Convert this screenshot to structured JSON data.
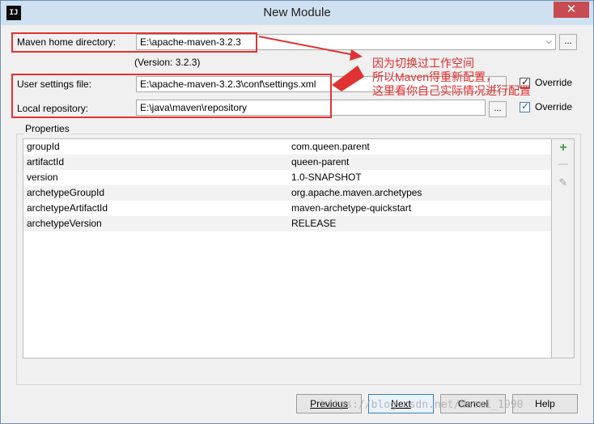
{
  "window": {
    "title": "New Module",
    "app_icon_text": "IJ",
    "close_glyph": "✕"
  },
  "maven": {
    "home_label": "Maven home directory:",
    "home_value": "E:\\apache-maven-3.2.3",
    "version_text": "(Version: 3.2.3)",
    "settings_label": "User settings file:",
    "settings_value": "E:\\apache-maven-3.2.3\\conf\\settings.xml",
    "repo_label": "Local repository:",
    "repo_value": "E:\\java\\maven\\repository",
    "override_label": "Override",
    "override_label_2": "Override",
    "browse_label": "...",
    "settings_override_checked": true,
    "repo_override_checked": true
  },
  "annotation": {
    "lines": [
      "因为切换过工作空间",
      "所以Maven得重新配置，",
      "这里看你自己实际情况进行配置"
    ],
    "color": "#e02b2b"
  },
  "properties": {
    "title": "Properties",
    "rows": [
      {
        "name": "groupId",
        "value": "com.queen.parent"
      },
      {
        "name": "artifactId",
        "value": "queen-parent"
      },
      {
        "name": "version",
        "value": "1.0-SNAPSHOT"
      },
      {
        "name": "archetypeGroupId",
        "value": "org.apache.maven.archetypes"
      },
      {
        "name": "archetypeArtifactId",
        "value": "maven-archetype-quickstart"
      },
      {
        "name": "archetypeVersion",
        "value": "RELEASE"
      }
    ],
    "tools": {
      "add_icon": "+",
      "remove_icon": "—",
      "edit_icon": "✎"
    }
  },
  "buttons": {
    "previous": "Previous",
    "next": "Next",
    "cancel": "Cancel",
    "help": "Help"
  },
  "watermark": "https://blog.csdn.net/Naomi_1990",
  "colors": {
    "accent": "#3c7fb1",
    "annotation": "#e02b2b",
    "close": "#c74b50"
  }
}
